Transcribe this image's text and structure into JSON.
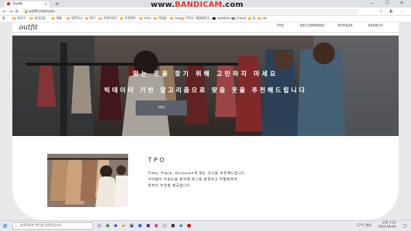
{
  "browser": {
    "tab_title": "Outfit",
    "tab_close": "×",
    "new_tab": "+",
    "url": "outfit.site/main",
    "nav": [
      "←",
      "→",
      "↻"
    ],
    "recorder_brand": "BANDICAM",
    "recorder_prefix": "www.",
    "recorder_suffix": ".com",
    "window_controls": "— ☐ ✕",
    "bookmarks": [
      "앱",
      "일반기",
      "알고리즘",
      "제출",
      "컴퓨터니",
      "여기",
      "프론트앤드",
      "프로젝트",
      "infra",
      "작업용",
      "mvp",
      "무인는 개발블로그...",
      "dyAdmin",
      "iCloud",
      "동",
      "etc"
    ]
  },
  "site": {
    "logo": "outfit",
    "gnb": [
      "TPO",
      "RECOMMEND",
      "MYPAGE",
      "SEARCH"
    ],
    "hero_title": "맞는 옷을 찾기 위해 고민하지 마세요",
    "hero_subtitle": "빅데이터 기반 알고리즘으로 맞춤 옷을 추천해드립니다",
    "section_title": "TPO",
    "section_desc": [
      "Time, Place, Occasion에 맞는 코디를 추천해드립니다",
      "아이템의 키워드를 분석해 태그를 분류하고 차별화하여",
      "회적의 추천을 제공합니다."
    ],
    "section_button": "TPO"
  },
  "taskbar": {
    "search_placeholder": "검색하려면 여기에 입력하십시오.",
    "weather": "17°C 맑음",
    "time": "오후 7:12",
    "date": "2022-04-04"
  }
}
